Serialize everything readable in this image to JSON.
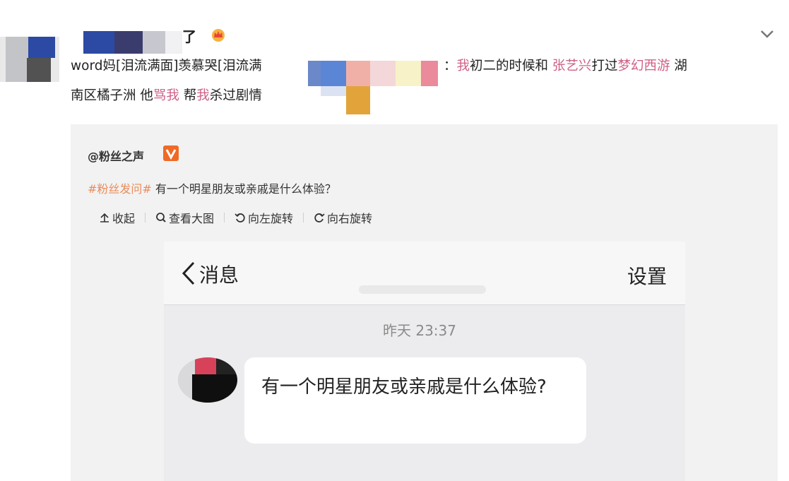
{
  "post": {
    "username_suffix": "了",
    "text_line1_start": "word妈[泪流满面]羡慕哭[泪流满",
    "text_line1_colon": "：",
    "text_line1_me": "我",
    "text_line1_mid": "初二的时候和 ",
    "text_line1_star": "张艺兴",
    "text_line1_played": "打过",
    "text_line1_game": "梦幻西游",
    "text_line1_end": " 湖",
    "text_line2_start": "南区橘子洲 他",
    "text_line2_scold": "骂我",
    "text_line2_help": " 帮",
    "text_line2_me": "我",
    "text_line2_end": "杀过剧情"
  },
  "retweet": {
    "author": "@粉丝之声",
    "topic_tag": "#粉丝发问#",
    "text": " 有一个明星朋友或亲戚是什么体验？",
    "actions": {
      "collapse": "收起",
      "view_large": "查看大图",
      "rotate_left": "向左旋转",
      "rotate_right": "向右旋转"
    }
  },
  "chat": {
    "back_label": "消息",
    "settings_label": "设置",
    "timestamp": "昨天 23:37",
    "message": "有一个明星朋友或亲戚是什么体验?"
  },
  "colors": {
    "highlight": "#d06088",
    "topic": "#e98c5c",
    "verified": "#ef6a25",
    "card_bg": "#f2f2f2"
  },
  "icons": [
    "crown-icon",
    "chevron-down-icon",
    "verified-icon",
    "collapse-icon",
    "magnifier-icon",
    "rotate-left-icon",
    "rotate-right-icon",
    "back-chevron-icon"
  ]
}
